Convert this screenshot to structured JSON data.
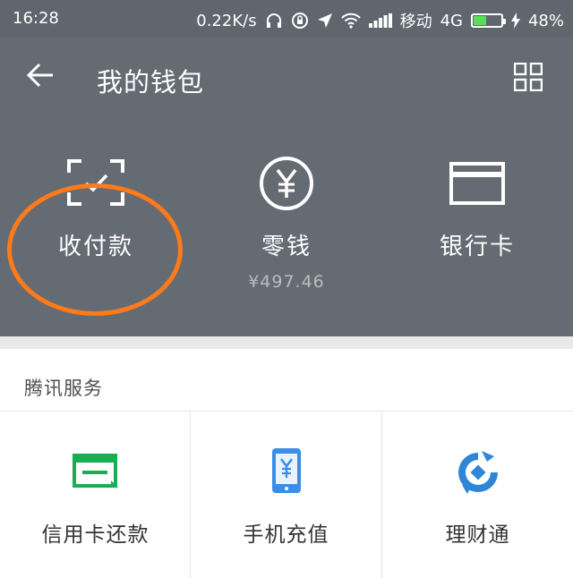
{
  "status_bar": {
    "time": "16:28",
    "speed": "0.22K/s",
    "carrier": "移动",
    "network": "4G",
    "battery": "48%",
    "battery_level": 0.48,
    "icons": [
      "headphones-icon",
      "alarm-lock-icon",
      "location-icon",
      "wifi-icon",
      "signal-icon",
      "battery-icon",
      "charging-icon"
    ]
  },
  "header": {
    "title": "我的钱包",
    "back_icon": "back-arrow-icon",
    "menu_icon": "grid-icon"
  },
  "wallet": {
    "features": [
      {
        "label": "收付款",
        "icon": "scan-check-icon"
      },
      {
        "label": "零钱",
        "icon": "yen-circle-icon",
        "balance": "¥497.46"
      },
      {
        "label": "银行卡",
        "icon": "bank-card-icon"
      }
    ],
    "highlight_color": "#ff7a1a"
  },
  "services": {
    "section_title": "腾讯服务",
    "items": [
      {
        "label": "信用卡还款",
        "icon": "credit-card-repay-icon",
        "color": "#1aad53"
      },
      {
        "label": "手机充值",
        "icon": "phone-topup-icon",
        "color": "#3a8ee6"
      },
      {
        "label": "理财通",
        "icon": "licaitong-icon",
        "color": "#2f86d6"
      }
    ]
  },
  "colors": {
    "header_bg": "#646b73",
    "status_bg": "#5f666e"
  }
}
